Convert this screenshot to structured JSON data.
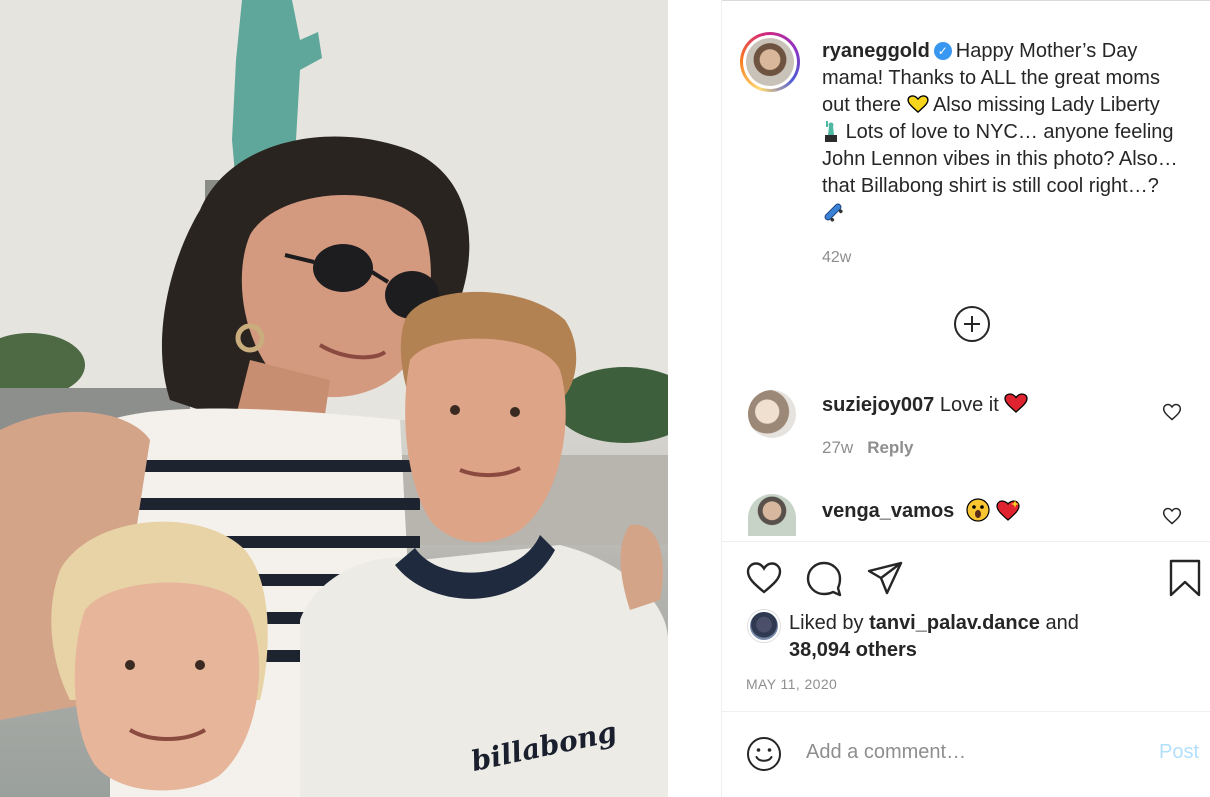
{
  "post": {
    "username": "ryaneggold",
    "verified_mark": "✓",
    "caption_text": "Happy Mother’s Day mama! Thanks to ALL the great moms out there",
    "caption_part2": "Also missing Lady Liberty",
    "caption_part3": "Lots of love to NYC… anyone feeling John Lennon vibes in this photo? Also… that Billabong shirt is still cool right…?",
    "time_ago": "42w",
    "shirt_text": "billabong"
  },
  "comments": [
    {
      "username": "suziejoy007",
      "text": "Love it",
      "time": "27w",
      "reply_label": "Reply"
    },
    {
      "username": "venga_vamos",
      "text": ""
    }
  ],
  "likes": {
    "prefix": "Liked by",
    "user": "tanvi_palav.dance",
    "joiner": "and",
    "others": "38,094 others"
  },
  "date": "MAY 11, 2020",
  "comment_box": {
    "placeholder": "Add a comment…",
    "post_label": "Post"
  },
  "icons": {
    "like": "heart-icon",
    "comment": "comment-icon",
    "share": "paper-plane-icon",
    "save": "bookmark-icon",
    "add": "plus-circle-icon",
    "emoji": "smiley-icon"
  },
  "colors": {
    "accent": "#3897f0",
    "post_disabled": "#b2dffc",
    "muted": "#8e8e8e",
    "text": "#262626"
  }
}
